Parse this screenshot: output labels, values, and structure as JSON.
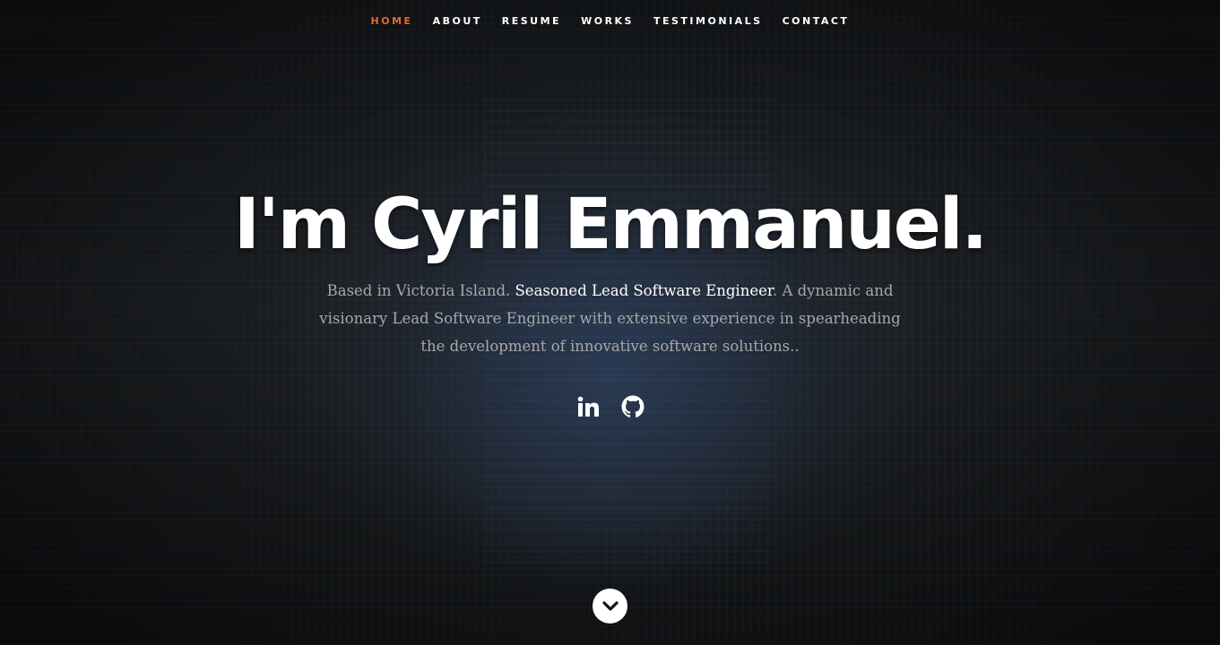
{
  "nav": {
    "items": [
      {
        "label": "HOME",
        "active": true
      },
      {
        "label": "ABOUT",
        "active": false
      },
      {
        "label": "RESUME",
        "active": false
      },
      {
        "label": "WORKS",
        "active": false
      },
      {
        "label": "TESTIMONIALS",
        "active": false
      },
      {
        "label": "CONTACT",
        "active": false
      }
    ],
    "active_color": "#e36b2c"
  },
  "hero": {
    "title": "I'm Cyril Emmanuel.",
    "intro_prefix": "Based in Victoria Island. ",
    "intro_highlight": "Seasoned Lead Software Engineer",
    "intro_suffix": ". A dynamic and visionary Lead Software Engineer with extensive experience in spearheading the development of innovative software solutions.."
  },
  "social": [
    {
      "icon": "linkedin-icon"
    },
    {
      "icon": "github-icon"
    }
  ],
  "scroll": {
    "icon": "chevron-down-icon"
  }
}
